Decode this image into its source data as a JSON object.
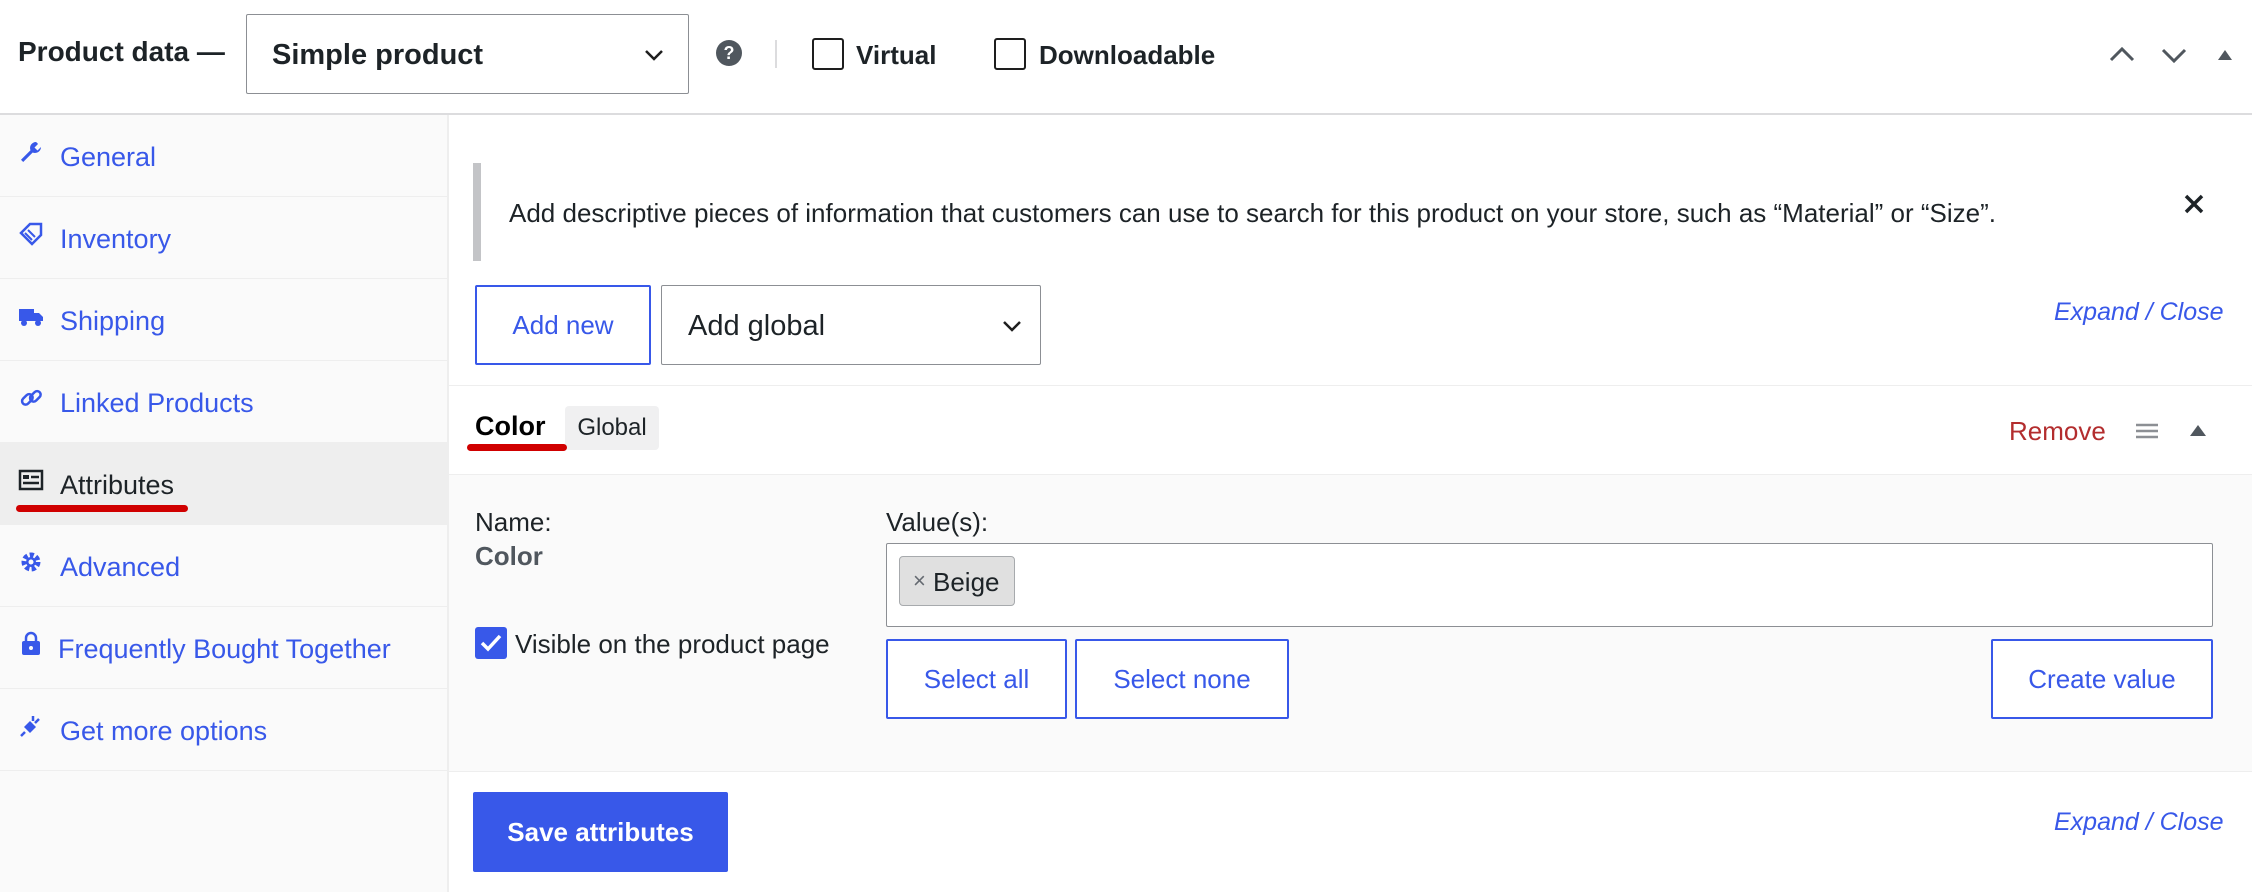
{
  "header": {
    "title": "Product data —",
    "product_type": "Simple product",
    "help_icon": "?",
    "virtual_label": "Virtual",
    "downloadable_label": "Downloadable"
  },
  "sidebar": {
    "items": [
      {
        "label": "General",
        "icon": "wrench-icon"
      },
      {
        "label": "Inventory",
        "icon": "tag-icon"
      },
      {
        "label": "Shipping",
        "icon": "truck-icon"
      },
      {
        "label": "Linked Products",
        "icon": "link-icon"
      },
      {
        "label": "Attributes",
        "icon": "list-icon",
        "active": true
      },
      {
        "label": "Advanced",
        "icon": "gear-icon"
      },
      {
        "label": "Frequently Bought Together",
        "icon": "bag-lock-icon"
      },
      {
        "label": "Get more options",
        "icon": "plugin-icon"
      }
    ]
  },
  "main": {
    "notice": "Add descriptive pieces of information that customers can use to search for this product on your store, such as “Material” or “Size”.",
    "add_new_label": "Add new",
    "add_global_value": "Add global",
    "expand_close": "Expand / Close",
    "attribute": {
      "name": "Color",
      "badge": "Global",
      "remove_label": "Remove",
      "name_label": "Name:",
      "name_value": "Color",
      "values_label": "Value(s):",
      "values": [
        {
          "remove": "×",
          "label": "Beige"
        }
      ],
      "visible_label": "Visible on the product page",
      "select_all_label": "Select all",
      "select_none_label": "Select none",
      "create_value_label": "Create value"
    },
    "save_label": "Save attributes"
  },
  "colors": {
    "accent": "#3858e9",
    "remove": "#b32d2e",
    "highlight_underline": "#d00000"
  }
}
